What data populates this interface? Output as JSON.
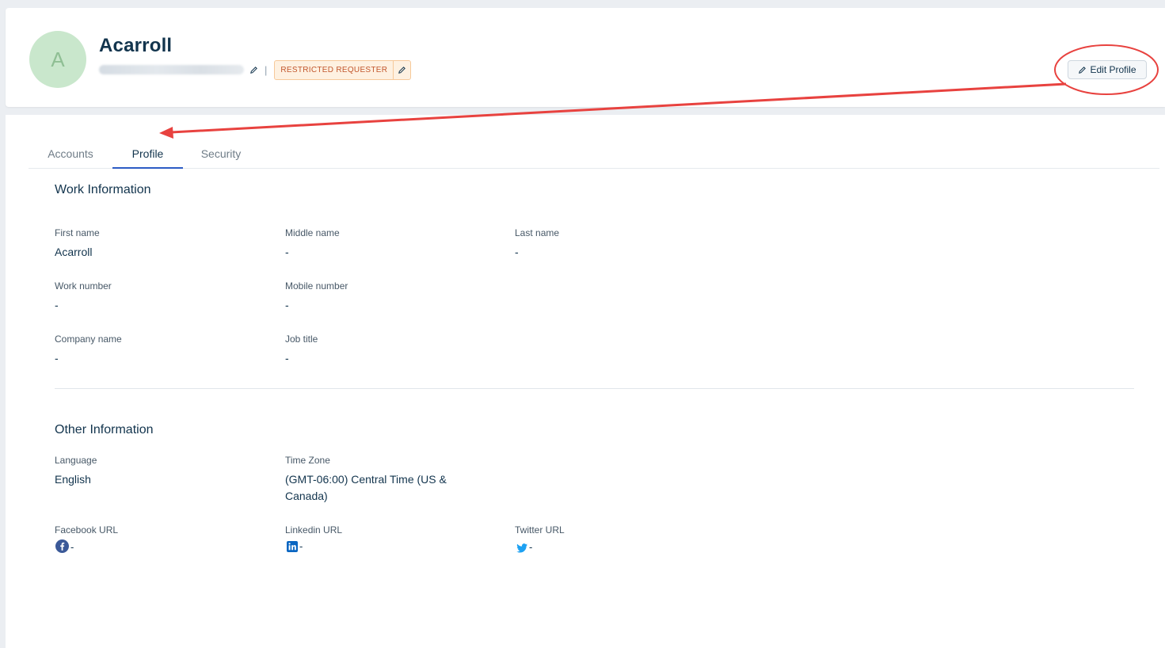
{
  "header": {
    "avatar_initial": "A",
    "user_name": "Acarroll",
    "role_badge": "RESTRICTED REQUESTER",
    "separator": "|",
    "edit_profile_label": "Edit Profile"
  },
  "tabs": [
    {
      "label": "Accounts",
      "active": false
    },
    {
      "label": "Profile",
      "active": true
    },
    {
      "label": "Security",
      "active": false
    }
  ],
  "work_info": {
    "title": "Work Information",
    "first_name": {
      "label": "First name",
      "value": "Acarroll"
    },
    "middle_name": {
      "label": "Middle name",
      "value": "-"
    },
    "last_name": {
      "label": "Last name",
      "value": "-"
    },
    "work_number": {
      "label": "Work number",
      "value": "-"
    },
    "mobile_number": {
      "label": "Mobile number",
      "value": "-"
    },
    "company_name": {
      "label": "Company name",
      "value": "-"
    },
    "job_title": {
      "label": "Job title",
      "value": "-"
    }
  },
  "other_info": {
    "title": "Other Information",
    "language": {
      "label": "Language",
      "value": "English"
    },
    "time_zone": {
      "label": "Time Zone",
      "value_line1": "(GMT-06:00) Central Time (US &",
      "value_line2": "Canada)"
    },
    "facebook": {
      "label": "Facebook URL",
      "value": "-",
      "icon": "facebook-icon"
    },
    "linkedin": {
      "label": "Linkedin URL",
      "value": "-",
      "icon": "linkedin-icon"
    },
    "twitter": {
      "label": "Twitter URL",
      "value": "-",
      "icon": "twitter-icon"
    }
  },
  "colors": {
    "accent": "#2c5cc5",
    "annotation": "#e8423f",
    "badge_bg": "#fef1e1",
    "badge_text": "#c2562c",
    "avatar_bg": "#c9e7cc"
  }
}
